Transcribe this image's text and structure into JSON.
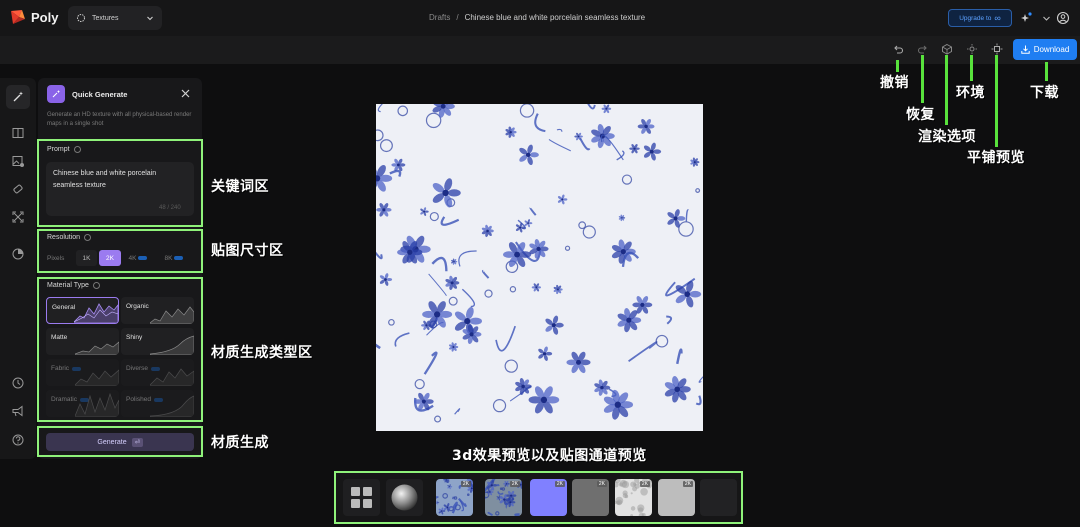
{
  "header": {
    "brand": "Poly",
    "workspace": "Textures",
    "breadcrumb_root": "Drafts",
    "breadcrumb_sep": "/",
    "breadcrumb_current": "Chinese blue and white porcelain seamless texture",
    "upgrade_label": "Upgrade to",
    "upgrade_suffix": "∞"
  },
  "toolbar": {
    "download_label": "Download"
  },
  "panel": {
    "title": "Quick Generate",
    "description": "Generate an HD texture with all physical-based render maps in a single shot",
    "prompt_label": "Prompt",
    "prompt_value": "Chinese blue and white porcelain seamless texture",
    "prompt_count": "48 / 240",
    "resolution_label": "Resolution",
    "pixels_label": "Pixels",
    "resolutions": [
      {
        "label": "1K",
        "pro": false
      },
      {
        "label": "2K",
        "pro": false,
        "selected": true
      },
      {
        "label": "4K",
        "pro": true
      },
      {
        "label": "8K",
        "pro": true
      }
    ],
    "material_label": "Material Type",
    "materials": [
      {
        "label": "General",
        "selected": true,
        "locked": false
      },
      {
        "label": "Organic",
        "locked": false
      },
      {
        "label": "Matte",
        "locked": false
      },
      {
        "label": "Shiny",
        "locked": false
      },
      {
        "label": "Fabric",
        "locked": true
      },
      {
        "label": "Diverse",
        "locked": true
      },
      {
        "label": "Dramatic",
        "locked": true
      },
      {
        "label": "Polished",
        "locked": true
      }
    ],
    "generate_label": "Generate",
    "generate_key": "⏎"
  },
  "annotations": {
    "undo": "撤销",
    "redo": "恢复",
    "render_options": "渲染选项",
    "environment": "环境",
    "tile_preview": "平铺预览",
    "download": "下载",
    "prompt_area": "关键词区",
    "resolution_area": "贴图尺寸区",
    "material_area": "材质生成类型区",
    "generate": "材质生成",
    "preview_strip": "3d效果预览以及贴图通道预览"
  },
  "thumbnails": [
    {
      "kind": "grid-view",
      "tag": ""
    },
    {
      "kind": "sphere",
      "tag": ""
    },
    {
      "kind": "base-color",
      "tag": "2K"
    },
    {
      "kind": "normal-detail",
      "tag": "2K"
    },
    {
      "kind": "normal",
      "tag": "2K"
    },
    {
      "kind": "roughness",
      "tag": "2K"
    },
    {
      "kind": "height",
      "tag": "2K"
    },
    {
      "kind": "metallic",
      "tag": "2K"
    },
    {
      "kind": "empty",
      "tag": ""
    }
  ],
  "colors": {
    "accent": "#9b7bf0",
    "download": "#1f7ef2",
    "annotation_green": "#8ff27a",
    "porcelain_blue": "#2a3fa8"
  }
}
